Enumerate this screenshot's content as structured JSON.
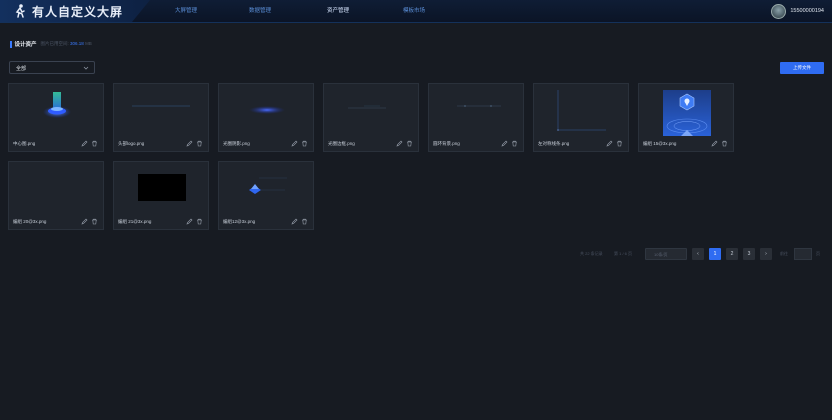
{
  "app": {
    "title": "有人自定义大屏"
  },
  "nav": {
    "items": [
      {
        "label": "大屏管理"
      },
      {
        "label": "数据管理"
      },
      {
        "label": "资产管理",
        "active": true
      },
      {
        "label": "模板市场"
      }
    ]
  },
  "user": {
    "name": "15500000194"
  },
  "section": {
    "title": "设计资产",
    "usage_prefix": "图片已用空间:",
    "usage_value": "306.18",
    "usage_suffix": "MB"
  },
  "filter": {
    "selected": "全部"
  },
  "toolbar": {
    "upload_label": "上传文件"
  },
  "assets": [
    {
      "name": "中心图.png"
    },
    {
      "name": "头部logo.png"
    },
    {
      "name": "光圈阴影.png"
    },
    {
      "name": "光圈边框.png"
    },
    {
      "name": "圆环背景.png"
    },
    {
      "name": "左对称线条.png"
    },
    {
      "name": "编组 15@3x.png"
    },
    {
      "name": "编组 20@3x.png"
    },
    {
      "name": "编组 21@3x.png"
    },
    {
      "name": "编组12@3x.png"
    }
  ],
  "pagination": {
    "total": "共 22 条记录",
    "pages": "第 1 / 6 页",
    "page_size": "10条/页",
    "prev": "‹",
    "next": "›",
    "page_numbers": [
      "1",
      "2",
      "3"
    ],
    "jump_label": "前往",
    "jump_suffix": "页"
  },
  "colors": {
    "accent": "#2f6cf2",
    "background": "#171b22",
    "card": "#1f242c"
  }
}
